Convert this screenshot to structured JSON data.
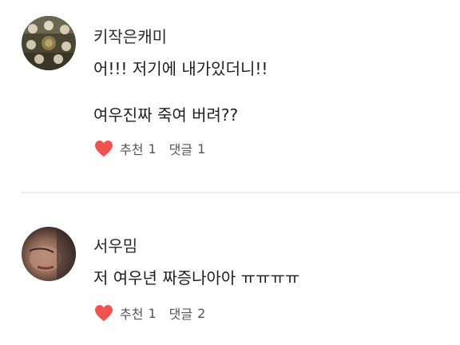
{
  "comments": [
    {
      "author": "키작은캐미",
      "lines": [
        "어!!! 저기에 내가있더니!!",
        "여우진짜 죽여 버려??"
      ],
      "like_label": "추천",
      "like_count": "1",
      "reply_label": "댓글",
      "reply_count": "1",
      "avatar_icon": "group-photo-avatar"
    },
    {
      "author": "서우밈",
      "lines": [
        "저 여우년 짜증나아아 ㅠㅠㅠㅠ"
      ],
      "like_label": "추천",
      "like_count": "1",
      "reply_label": "댓글",
      "reply_count": "2",
      "avatar_icon": "face-photo-avatar"
    }
  ],
  "colors": {
    "heart": "#f0524f",
    "divider": "#e6eef2",
    "text": "#1e1e1e",
    "meta": "#555555"
  }
}
